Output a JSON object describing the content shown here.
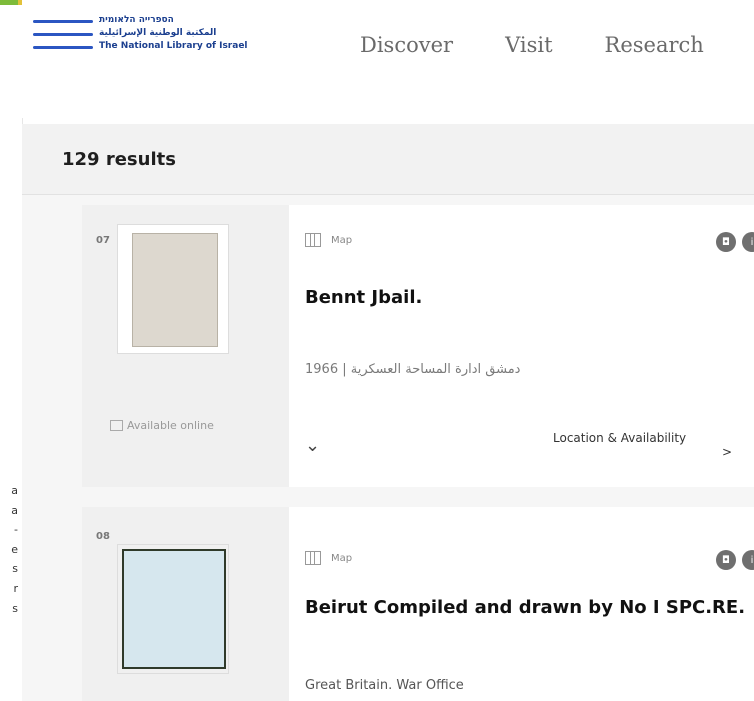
{
  "header": {
    "logo_lines": [
      "הספרייה הלאומית",
      "المكتبة الوطنية الإسرائيلية",
      "The National Library of Israel"
    ],
    "nav": [
      "Discover",
      "Visit",
      "Research"
    ]
  },
  "results": {
    "count_label": "129 results"
  },
  "gutter": {
    "lines": [
      "a",
      "a",
      "-",
      "e",
      "s",
      "r",
      "s"
    ]
  },
  "cards": [
    {
      "number": "07",
      "type": "Map",
      "title": "Bennt Jbail.",
      "meta": "1966 | دمشق ادارة المساحة العسكرية",
      "availability": "Available online",
      "location_label": "Location & Availability",
      "arrow": ">"
    },
    {
      "number": "08",
      "type": "Map",
      "title": "Beirut Compiled and drawn by No I SPC.RE.",
      "meta": "Great Britain. War Office"
    }
  ],
  "colors": {
    "brand_blue": "#2b56c2",
    "results_bar": "#f2f2f2",
    "badge": "#6f6f6f"
  }
}
